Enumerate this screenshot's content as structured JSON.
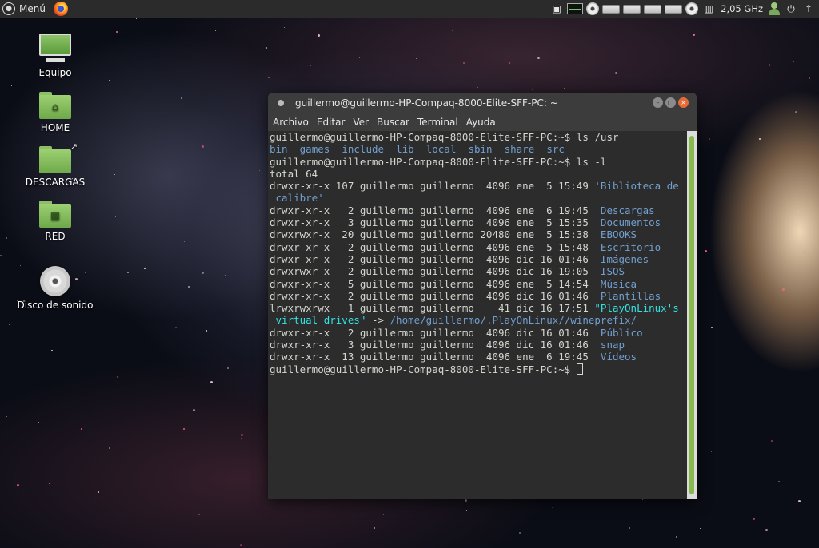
{
  "top_panel": {
    "menu_label": "Menú",
    "cpu_freq": "2,05 GHz"
  },
  "desktop": {
    "icons": [
      {
        "label": "Equipo"
      },
      {
        "label": "HOME"
      },
      {
        "label": "DESCARGAS"
      },
      {
        "label": "RED"
      },
      {
        "label": "Disco de sonido"
      }
    ]
  },
  "terminal": {
    "title": "guillermo@guillermo-HP-Compaq-8000-Elite-SFF-PC: ~",
    "menu": [
      "Archivo",
      "Editar",
      "Ver",
      "Buscar",
      "Terminal",
      "Ayuda"
    ],
    "prompt": "guillermo@guillermo-HP-Compaq-8000-Elite-SFF-PC:~$",
    "cmd1": "ls /usr",
    "usr_entries": [
      "bin",
      "games",
      "include",
      "lib",
      "local",
      "sbin",
      "share",
      "src"
    ],
    "cmd2": "ls -l",
    "total": "total 64",
    "listing": [
      {
        "perm": "drwxr-xr-x",
        "links": "107",
        "user": "guillermo",
        "group": "guillermo",
        "size": " 4096",
        "month": "ene",
        "day": " 5",
        "time": "15:49",
        "name": "'Biblioteca de",
        "kind": "dir",
        "cont": " calibre'"
      },
      {
        "perm": "drwxr-xr-x",
        "links": "  2",
        "user": "guillermo",
        "group": "guillermo",
        "size": " 4096",
        "month": "ene",
        "day": " 6",
        "time": "19:45",
        "name": " Descargas",
        "kind": "dir"
      },
      {
        "perm": "drwxr-xr-x",
        "links": "  3",
        "user": "guillermo",
        "group": "guillermo",
        "size": " 4096",
        "month": "ene",
        "day": " 5",
        "time": "15:35",
        "name": " Documentos",
        "kind": "dir"
      },
      {
        "perm": "drwxrwxr-x",
        "links": " 20",
        "user": "guillermo",
        "group": "guillermo",
        "size": "20480",
        "month": "ene",
        "day": " 5",
        "time": "15:38",
        "name": " EBOOKS",
        "kind": "dir"
      },
      {
        "perm": "drwxr-xr-x",
        "links": "  2",
        "user": "guillermo",
        "group": "guillermo",
        "size": " 4096",
        "month": "ene",
        "day": " 5",
        "time": "15:48",
        "name": " Escritorio",
        "kind": "dir"
      },
      {
        "perm": "drwxr-xr-x",
        "links": "  2",
        "user": "guillermo",
        "group": "guillermo",
        "size": " 4096",
        "month": "dic",
        "day": "16",
        "time": "01:46",
        "name": " Imágenes",
        "kind": "dir"
      },
      {
        "perm": "drwxrwxr-x",
        "links": "  2",
        "user": "guillermo",
        "group": "guillermo",
        "size": " 4096",
        "month": "dic",
        "day": "16",
        "time": "19:05",
        "name": " ISOS",
        "kind": "dir"
      },
      {
        "perm": "drwxr-xr-x",
        "links": "  5",
        "user": "guillermo",
        "group": "guillermo",
        "size": " 4096",
        "month": "ene",
        "day": " 5",
        "time": "14:54",
        "name": " Música",
        "kind": "dir"
      },
      {
        "perm": "drwxr-xr-x",
        "links": "  2",
        "user": "guillermo",
        "group": "guillermo",
        "size": " 4096",
        "month": "dic",
        "day": "16",
        "time": "01:46",
        "name": " Plantillas",
        "kind": "dir"
      },
      {
        "perm": "lrwxrwxrwx",
        "links": "  1",
        "user": "guillermo",
        "group": "guillermo",
        "size": "   41",
        "month": "dic",
        "day": "16",
        "time": "17:51",
        "name": "\"PlayOnLinux's",
        "kind": "link",
        "cont": " virtual drives\"",
        "arrow": " -> ",
        "target": "/home/guillermo/.PlayOnLinux//wineprefix/"
      },
      {
        "perm": "drwxr-xr-x",
        "links": "  2",
        "user": "guillermo",
        "group": "guillermo",
        "size": " 4096",
        "month": "dic",
        "day": "16",
        "time": "01:46",
        "name": " Público",
        "kind": "dir"
      },
      {
        "perm": "drwxr-xr-x",
        "links": "  3",
        "user": "guillermo",
        "group": "guillermo",
        "size": " 4096",
        "month": "dic",
        "day": "16",
        "time": "01:46",
        "name": " snap",
        "kind": "dir"
      },
      {
        "perm": "drwxr-xr-x",
        "links": " 13",
        "user": "guillermo",
        "group": "guillermo",
        "size": " 4096",
        "month": "ene",
        "day": " 6",
        "time": "19:45",
        "name": " Vídeos",
        "kind": "dir"
      }
    ]
  },
  "colors": {
    "terminal_bg": "#2c2c2c",
    "dir": "#729fcf",
    "link": "#34e2e2",
    "accent": "#87b94f"
  },
  "icons": [
    "menu-logo-icon",
    "firefox-icon",
    "display-settings-icon",
    "system-monitor-icon",
    "cd-drive-icon",
    "hard-drive-icon",
    "cpu-freq-icon",
    "user-icon",
    "power-icon",
    "update-icon"
  ]
}
